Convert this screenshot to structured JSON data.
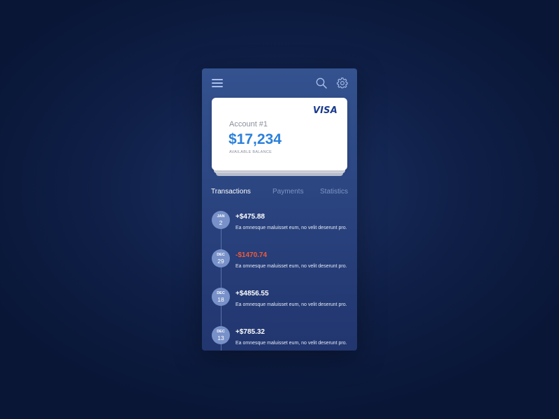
{
  "header": {
    "menu_icon": "hamburger-menu-icon",
    "search_icon": "search-icon",
    "settings_icon": "gear-icon"
  },
  "card": {
    "brand": "VISA",
    "account_name": "Account #1",
    "balance": "$17,234",
    "balance_label": "AVAILABLE BALANCE"
  },
  "tabs": [
    {
      "label": "Transactions",
      "active": true
    },
    {
      "label": "Payments",
      "active": false
    },
    {
      "label": "Statistics",
      "active": false
    }
  ],
  "transactions": [
    {
      "month": "JAN",
      "day": "2",
      "amount": "+$475.88",
      "type": "credit",
      "description": "Ea omnesque maluisset eum, no velit deserunt pro."
    },
    {
      "month": "DEC",
      "day": "29",
      "amount": "-$1470.74",
      "type": "debit",
      "description": "Ea omnesque maluisset eum, no velit deserunt pro."
    },
    {
      "month": "DEC",
      "day": "18",
      "amount": "+$4856.55",
      "type": "credit",
      "description": "Ea omnesque maluisset eum, no velit deserunt pro."
    },
    {
      "month": "DEC",
      "day": "13",
      "amount": "+$785.32",
      "type": "credit",
      "description": "Ea omnesque maluisset eum, no velit deserunt pro."
    }
  ],
  "colors": {
    "accent_blue": "#2b80db",
    "negative_amount": "#f05a3a",
    "badge": "#7891c9",
    "panel_top": "#34528f",
    "panel_bottom": "#22366f"
  }
}
